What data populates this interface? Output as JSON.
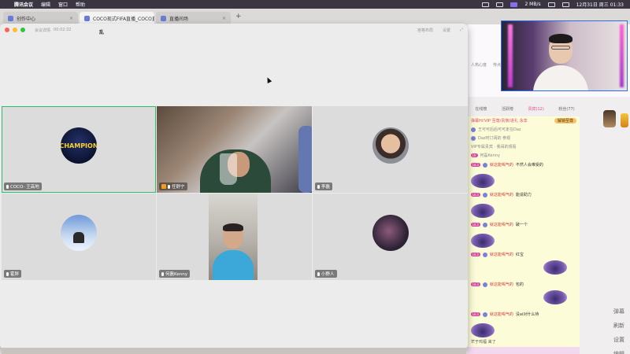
{
  "menubar": {
    "app": "腾讯会议",
    "items": [
      "编辑",
      "窗口",
      "帮助"
    ],
    "net_speed": "2 MB/s",
    "clock": "12月31日 周三  01:33"
  },
  "browser": {
    "tabs": [
      {
        "title": "创作中心",
        "close": "×"
      },
      {
        "title": "COCO现式FIFA直播_COCO直...",
        "close": "×"
      },
      {
        "title": "直播间场",
        "close": "×"
      }
    ],
    "add_tab": "+"
  },
  "meeting": {
    "title_info": "会议详情",
    "duration": "00:02:32",
    "controls": [
      "宫格布局",
      "设置"
    ],
    "participants": [
      {
        "name": "COCO- 王高地",
        "avatar": "champion-badge",
        "active": true,
        "avatar_text": "CHAMPION"
      },
      {
        "name": "任舒宁",
        "avatar": "video",
        "host": true
      },
      {
        "name": "李磊",
        "avatar": "kid-photo"
      },
      {
        "name": "霍胖",
        "avatar": "sky-photo"
      },
      {
        "name": "何磊Kenny",
        "avatar": "video-portrait"
      },
      {
        "name": "小野人",
        "avatar": "dark-photo"
      }
    ],
    "logo_text": "乱"
  },
  "stream": {
    "top_badges": [
      "人热心度",
      "传点"
    ],
    "rank_tabs": [
      {
        "label": "在线榜",
        "active": false
      },
      {
        "label": "活跃榜",
        "active": false
      },
      {
        "label": "贵宾(12)",
        "active": true
      },
      {
        "label": "粉丝(77)",
        "active": false
      }
    ],
    "notice": "弹幕Hi!VIP 至尊/贵族/进礼 永享",
    "notice_button": "解锁至尊",
    "vip_lines": [
      "王可可后后可可走在Daz",
      "Daz时订阅的 参观",
      "VIP专属贵宾 · 我哥的观看",
      "何磊Kenny"
    ],
    "chat": [
      {
        "level": "LV.3",
        "user": "就这能喝气的",
        "msg": "不然人会难受的"
      },
      {
        "level": "LV.3",
        "user": "就这能喝气的",
        "msg": "能说助力"
      },
      {
        "level": "LV.3",
        "user": "就这能喝气的",
        "msg": "破一个"
      },
      {
        "level": "LV.3",
        "user": "就这能喝气的",
        "msg": "红宝"
      },
      {
        "level": "LV.3",
        "user": "就这能喝气的",
        "msg": "包的"
      },
      {
        "level": "LV.3",
        "user": "就这能喝气的",
        "msg": "没ai对什么待"
      }
    ],
    "entry": "芒于鸡福  来了",
    "tools": [
      "弹幕",
      "刷新",
      "设置",
      "编辑"
    ]
  }
}
